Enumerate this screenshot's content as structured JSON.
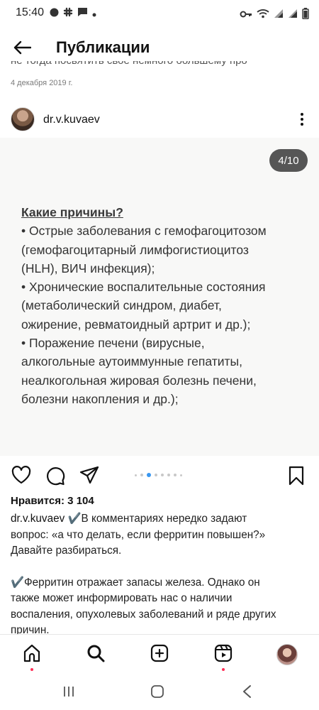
{
  "status_bar": {
    "time": "15:40",
    "left_icons": [
      "dot-icon",
      "slack-icon",
      "message-icon",
      "small-dot-icon"
    ],
    "right_icons": [
      "key-icon",
      "wifi-icon",
      "signal-icon",
      "signal-icon",
      "battery-icon"
    ]
  },
  "header": {
    "title": "Публикации"
  },
  "previous_post": {
    "caption_fragment": "не тогда посвятить свое немного большему про",
    "date": "4 декабря 2019 г."
  },
  "post": {
    "username": "dr.v.kuvaev",
    "counter": "4/10",
    "slide": {
      "heading": "Какие причины?",
      "lines": [
        "• Острые заболевания с гемофагоцитозом",
        "(гемофагоцитарный лимфогистиоцитоз",
        "(HLH), ВИЧ инфекция);",
        "• Хронические воспалительные состояния",
        "(метаболический синдром, диабет,",
        "ожирение, ревматоидный артрит и др.);",
        "• Поражение печени (вирусные,",
        "алкогольные аутоиммунные гепатиты,",
        "неалкогольная жировая болезнь печени,",
        "болезни накопления и др.);"
      ]
    },
    "likes": "Нравится: 3 104",
    "caption_user": "dr.v.kuvaev",
    "caption_lines": [
      " ✔️В комментариях нередко задают",
      "вопрос: «а что делать, если ферритин повышен?»",
      "Давайте разбираться."
    ],
    "caption_lines_2": [
      "✔️Ферритин отражает запасы железа. Однако он",
      "также может информировать нас о наличии",
      "воспаления, опухолевых заболеваний и ряде других",
      "причин."
    ],
    "carousel": {
      "current": 4,
      "total": 10,
      "visible_dots": 8,
      "active_dot": 2
    }
  },
  "colors": {
    "accent_blue": "#3897f0",
    "notification": "#ff2d55",
    "counter_bg": "#323232"
  }
}
